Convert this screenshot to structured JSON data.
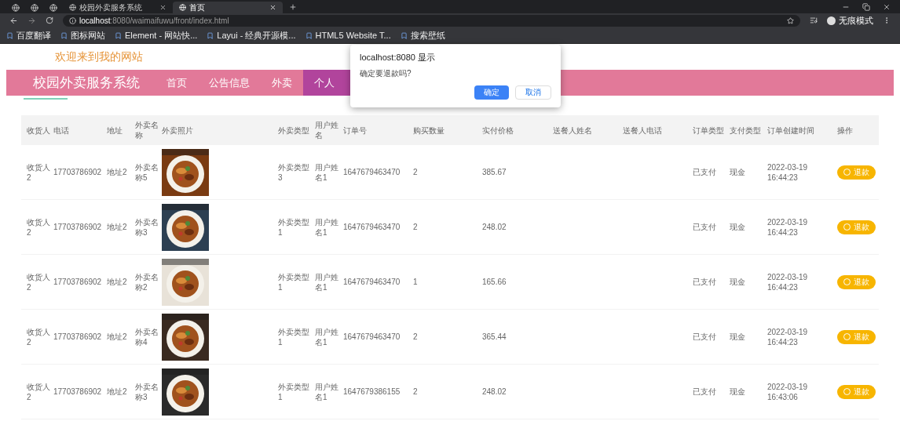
{
  "browser": {
    "tabs": [
      {
        "kind": "pinned",
        "selected": false
      },
      {
        "kind": "pinned",
        "selected": false
      },
      {
        "kind": "pinned",
        "selected": false
      },
      {
        "title": "校园外卖服务系统",
        "kind": "page",
        "selected": false
      },
      {
        "title": "首页",
        "kind": "page",
        "selected": true
      }
    ],
    "url_host": "localhost",
    "url_rest": ":8080/waimaifuwu/front/index.html",
    "profile": "无痕模式",
    "bookmarks": [
      "百度翻译",
      "图标网站",
      "Element - 网站快...",
      "Layui - 经典开源模...",
      "HTML5 Website T...",
      "搜索壁纸"
    ]
  },
  "welcome": "欢迎来到我的网站",
  "nav": {
    "title": "校园外卖服务系统",
    "items": [
      {
        "label": "首页",
        "selected": false
      },
      {
        "label": "公告信息",
        "selected": false
      },
      {
        "label": "外卖",
        "selected": false
      },
      {
        "label": "个人",
        "selected": true
      }
    ]
  },
  "table": {
    "columns": [
      "收货人",
      "电话",
      "地址",
      "外卖名称",
      "外卖照片",
      "外卖类型",
      "用户姓名",
      "订单号",
      "购买数量",
      "实付价格",
      "送餐人姓名",
      "送餐人电话",
      "订单类型",
      "支付类型",
      "订单创建时间",
      "操作"
    ],
    "rows": [
      {
        "receiver": "收货人2",
        "phone": "17703786902",
        "address": "地址2",
        "name": "外卖名称5",
        "type": "外卖类型3",
        "user": "用户姓名1",
        "order_no": "1647679463470",
        "qty": "2",
        "price": "385.67",
        "status": "已支付",
        "pay": "现金",
        "created": "2022-03-19 16:44:23",
        "action": "退款"
      },
      {
        "receiver": "收货人2",
        "phone": "17703786902",
        "address": "地址2",
        "name": "外卖名称3",
        "type": "外卖类型1",
        "user": "用户姓名1",
        "order_no": "1647679463470",
        "qty": "2",
        "price": "248.02",
        "status": "已支付",
        "pay": "现金",
        "created": "2022-03-19 16:44:23",
        "action": "退款"
      },
      {
        "receiver": "收货人2",
        "phone": "17703786902",
        "address": "地址2",
        "name": "外卖名称2",
        "type": "外卖类型1",
        "user": "用户姓名1",
        "order_no": "1647679463470",
        "qty": "1",
        "price": "165.66",
        "status": "已支付",
        "pay": "现金",
        "created": "2022-03-19 16:44:23",
        "action": "退款"
      },
      {
        "receiver": "收货人2",
        "phone": "17703786902",
        "address": "地址2",
        "name": "外卖名称4",
        "type": "外卖类型1",
        "user": "用户姓名1",
        "order_no": "1647679463470",
        "qty": "2",
        "price": "365.44",
        "status": "已支付",
        "pay": "现金",
        "created": "2022-03-19 16:44:23",
        "action": "退款"
      },
      {
        "receiver": "收货人2",
        "phone": "17703786902",
        "address": "地址2",
        "name": "外卖名称3",
        "type": "外卖类型1",
        "user": "用户姓名1",
        "order_no": "1647679386155",
        "qty": "2",
        "price": "248.02",
        "status": "已支付",
        "pay": "现金",
        "created": "2022-03-19 16:43:06",
        "action": "退款"
      }
    ]
  },
  "dialog": {
    "title": "localhost:8080 显示",
    "message": "确定要退款吗?",
    "buttons": [
      {
        "label": "确定",
        "kind": "primary"
      },
      {
        "label": "取消",
        "kind": "secondary"
      }
    ]
  }
}
